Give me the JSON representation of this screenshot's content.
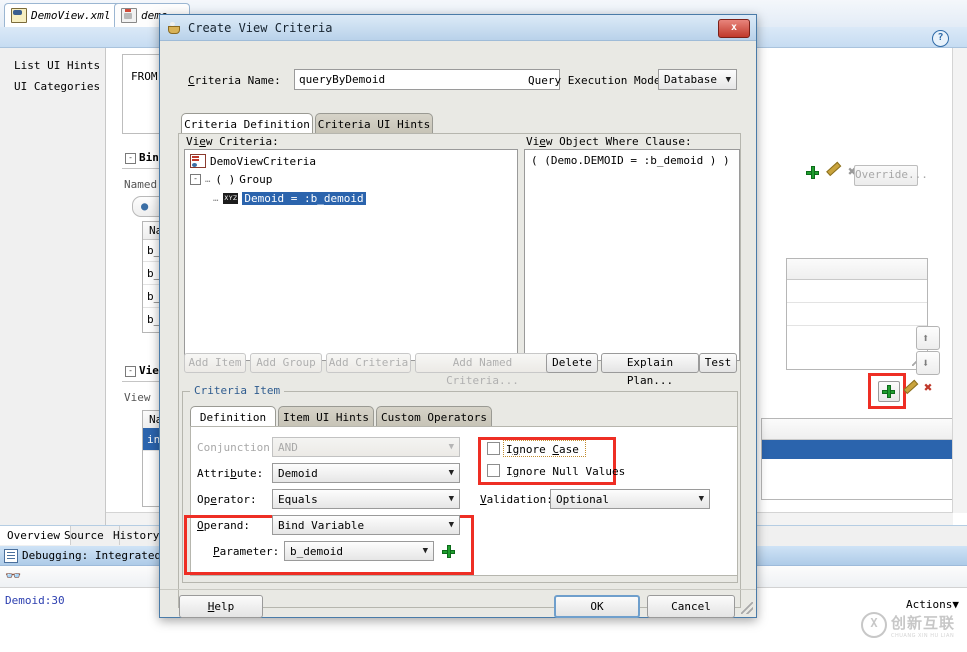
{
  "ide": {
    "tabs": [
      {
        "label": "DemoView.xml",
        "icon": "xml-file-icon",
        "active": true,
        "closable": true
      },
      {
        "label": "demo",
        "icon": "java-file-icon",
        "active": false,
        "closable": false
      }
    ],
    "help_icon": "?",
    "structure_items": [
      "List UI Hints",
      "UI Categories"
    ],
    "center": {
      "query_text": "FROM D",
      "bind_section_title": "Bin",
      "bind_section_label": "Named",
      "bind_col_header": "Na",
      "bind_rows": [
        "b_",
        "b_",
        "b_s",
        "b_s"
      ],
      "view_section_title": "Vie",
      "view_section_label": "View",
      "view_col_header": "Na",
      "view_rows": [
        "in"
      ],
      "override_button": "Override...",
      "add_icon": "plus-icon",
      "edit_icon": "pencil-icon",
      "delete_icon": "delete-x-icon",
      "move_up_icon": "arrow-up-icon",
      "move_down_icon": "arrow-down-icon"
    },
    "bottom": {
      "tabs": [
        "Overview",
        "Source",
        "History"
      ],
      "active_tab": "Overview",
      "log_title": "Debugging: IntegratedWe",
      "log_line": "Demoid:30",
      "actions_label": "Actions",
      "search_icon": "binoculars-icon",
      "minimize_label": "-"
    },
    "watermark": {
      "mark": "X",
      "cn": "创新互联",
      "py": "CHUANG XIN HU LIAN"
    }
  },
  "dialog": {
    "title": "Create View Criteria",
    "icon": "coffee-cup-icon",
    "close_label": "x",
    "criteria_name_label": "Criteria Name:",
    "criteria_name_value": "queryByDemoid",
    "query_mode_label": "Query Execution Mode:",
    "query_mode_value": "Database",
    "tabs": [
      {
        "label": "Criteria Definition",
        "active": true
      },
      {
        "label": "Criteria UI Hints",
        "active": false
      }
    ],
    "view_criteria_label": "View Criteria:",
    "tree": {
      "root": {
        "label": "DemoViewCriteria",
        "icon": "view-criteria-icon"
      },
      "group": {
        "label": "Group",
        "prefix": "( )",
        "expander": "-"
      },
      "item": {
        "label": "Demoid = :b_demoid",
        "icon": "xyz-icon",
        "selected": true
      }
    },
    "where_clause_label": "View Object Where Clause:",
    "where_clause_value": "( (Demo.DEMOID = :b_demoid ) )",
    "tree_buttons": [
      {
        "label": "Add Item",
        "disabled": true
      },
      {
        "label": "Add Group",
        "disabled": true
      },
      {
        "label": "Add Criteria",
        "disabled": true
      },
      {
        "label": "Add Named Criteria...",
        "disabled": true
      },
      {
        "label": "Delete",
        "disabled": false
      },
      {
        "label": "Explain Plan...",
        "disabled": false
      },
      {
        "label": "Test",
        "disabled": false
      }
    ],
    "criteria_item": {
      "group_title": "Criteria Item",
      "tabs": [
        {
          "label": "Definition",
          "active": true
        },
        {
          "label": "Item UI Hints",
          "active": false
        },
        {
          "label": "Custom Operators",
          "active": false
        }
      ],
      "conjunction_label": "Conjunction:",
      "conjunction_value": "AND",
      "conjunction_disabled": true,
      "attribute_label": "Attribute:",
      "attribute_value": "Demoid",
      "operator_label": "Operator:",
      "operator_value": "Equals",
      "operand_label": "Operand:",
      "operand_value": "Bind Variable",
      "parameter_label": "Parameter:",
      "parameter_value": "b_demoid",
      "parameter_add_icon": "plus-icon",
      "ignore_case_label": "Ignore Case",
      "ignore_case_checked": false,
      "ignore_null_label": "Ignore Null Values",
      "ignore_null_checked": false,
      "validation_label": "Validation:",
      "validation_value": "Optional"
    },
    "footer": {
      "help_label": "Help",
      "ok_label": "OK",
      "cancel_label": "Cancel"
    }
  },
  "highlights": {
    "color": "#ee2e24"
  }
}
